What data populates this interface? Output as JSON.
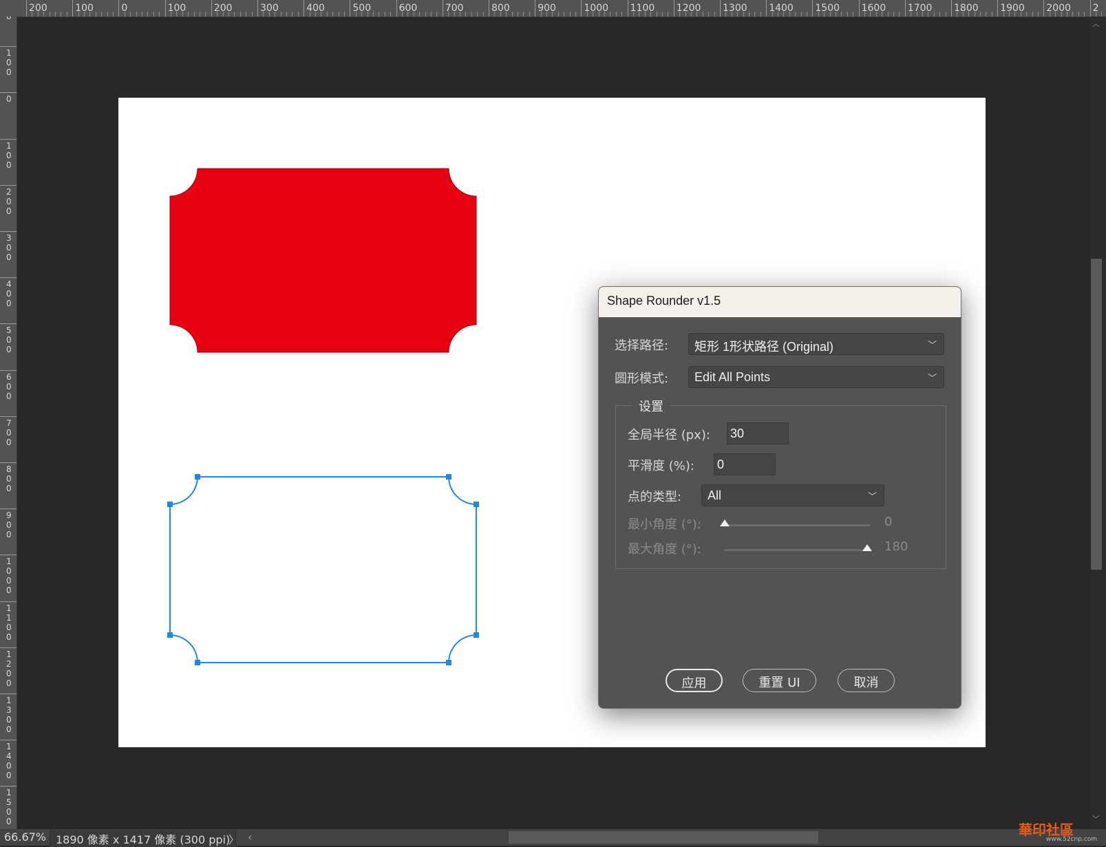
{
  "rulers": {
    "top_labels": [
      "200",
      "100",
      "0",
      "100",
      "200",
      "300",
      "400",
      "500",
      "600",
      "700",
      "800",
      "900",
      "1000",
      "1100",
      "1200",
      "1300",
      "1400",
      "1500",
      "1600",
      "1700",
      "1800",
      "1900",
      "2000",
      "2"
    ],
    "left_labels": [
      "00",
      "100",
      "0",
      "100",
      "200",
      "300",
      "400",
      "500",
      "600",
      "700",
      "800",
      "900",
      "1000",
      "1100",
      "1200",
      "1300",
      "1400",
      "1500"
    ]
  },
  "dialog": {
    "title": "Shape Rounder v1.5",
    "select_path_label": "选择路径:",
    "select_path_value": "矩形 1形状路径 (Original)",
    "round_mode_label": "圆形模式:",
    "round_mode_value": "Edit All Points",
    "settings_legend": "设置",
    "global_radius_label": "全局半径 (px):",
    "global_radius_value": "30",
    "smoothness_label": "平滑度 (%):",
    "smoothness_value": "0",
    "point_type_label": "点的类型:",
    "point_type_value": "All",
    "min_angle_label": "最小角度 (°):",
    "min_angle_value": "0",
    "max_angle_label": "最大角度 (°):",
    "max_angle_value": "180",
    "apply_button": "应用",
    "reset_button": "重置 UI",
    "cancel_button": "取消"
  },
  "status": {
    "zoom": "66.67%",
    "doc_info": "1890 像素 x 1417 像素 (300 ppi)",
    "chevron": "〉",
    "prev": "‹"
  },
  "watermark": {
    "text": "華印社區",
    "sub": "www.52cnp.com"
  },
  "colors": {
    "shape_fill": "#e60012",
    "path_stroke": "#1e88e5",
    "anchor": "#1e88e5"
  }
}
